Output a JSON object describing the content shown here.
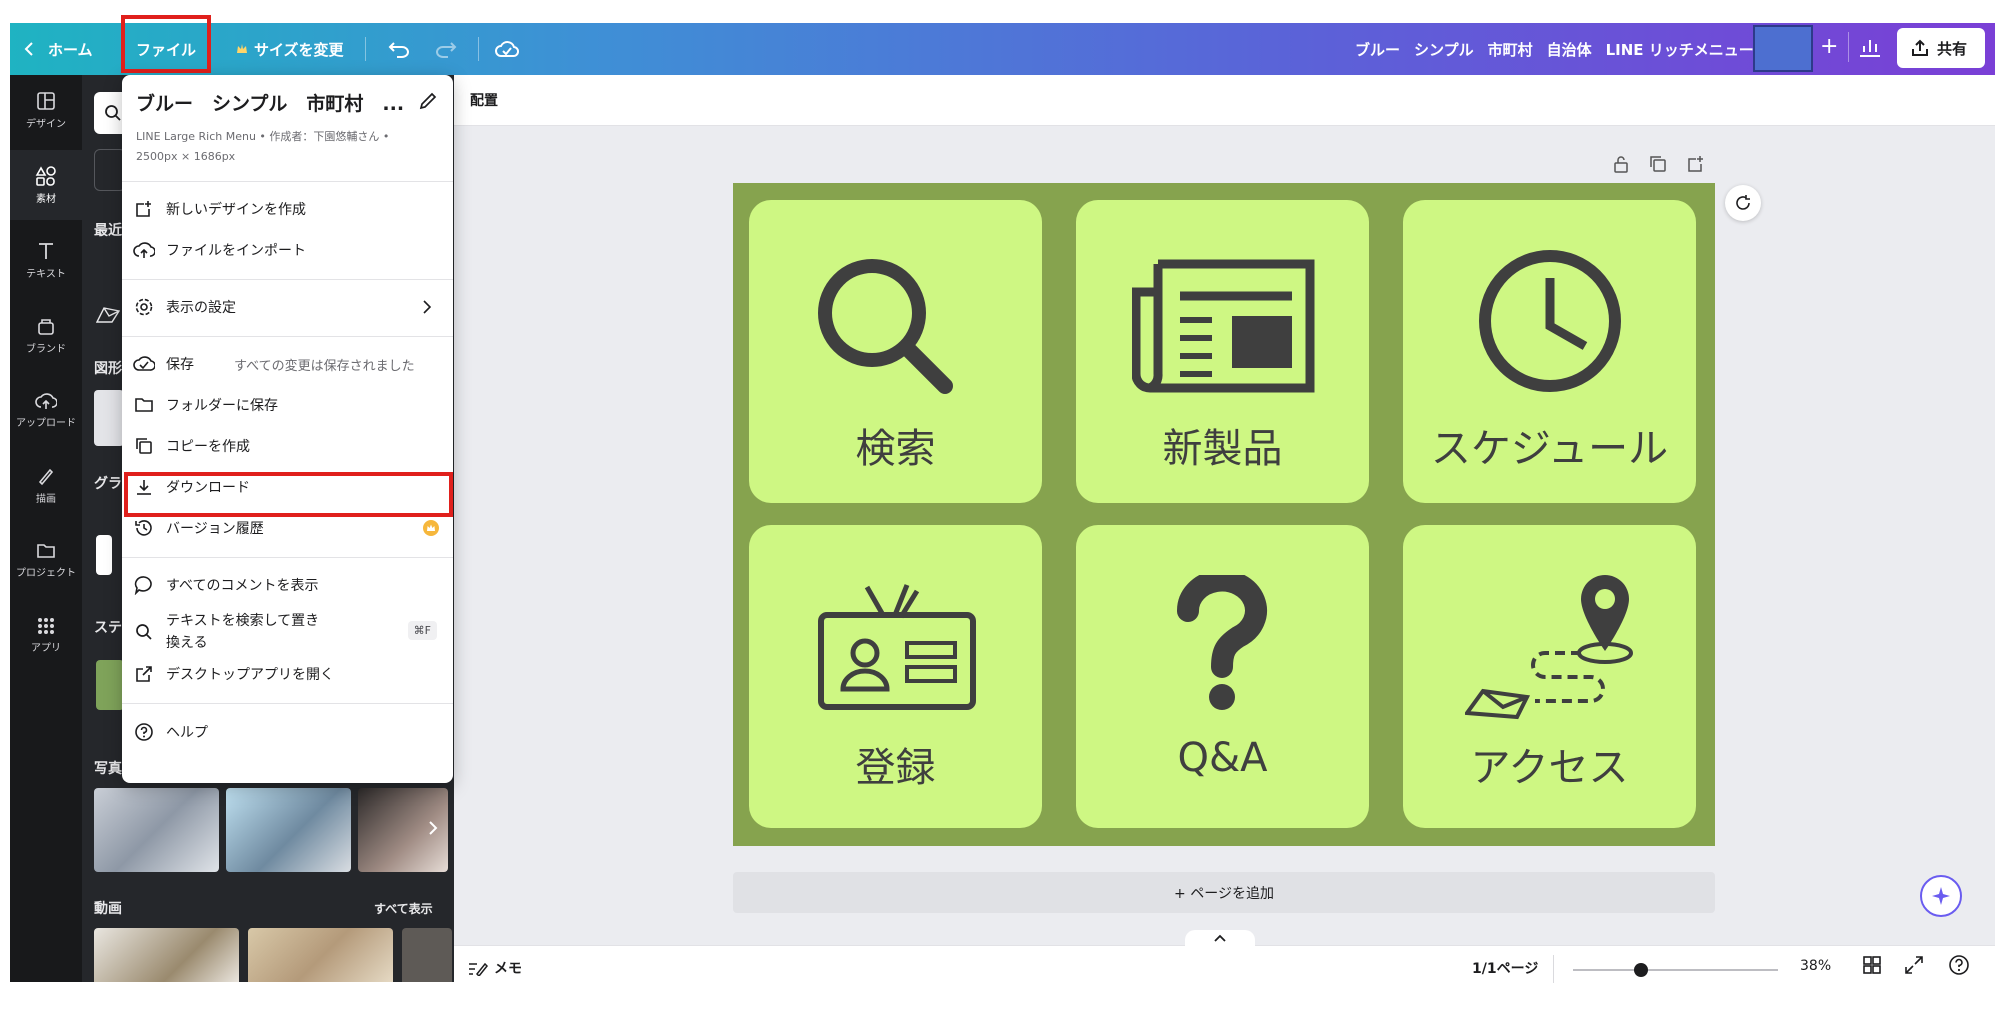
{
  "topbar": {
    "home_label": "ホーム",
    "file_label": "ファイル",
    "resize_label": "サイズを変更",
    "title_tags": [
      "ブルー",
      "シンプル",
      "市町村",
      "自治体",
      "LINE リッチメニュー"
    ],
    "share_label": "共有",
    "swatch_color": "#4d6fd0"
  },
  "rail": [
    {
      "label": "デザイン",
      "icon": "layout-icon"
    },
    {
      "label": "素材",
      "icon": "elements-icon"
    },
    {
      "label": "テキスト",
      "icon": "text-icon"
    },
    {
      "label": "ブランド",
      "icon": "brand-icon"
    },
    {
      "label": "アップロード",
      "icon": "upload-icon"
    },
    {
      "label": "描画",
      "icon": "draw-icon"
    },
    {
      "label": "プロジェクト",
      "icon": "folder-icon"
    },
    {
      "label": "アプリ",
      "icon": "apps-icon"
    }
  ],
  "panel": {
    "recent_label": "最近",
    "shapes_label": "図形",
    "graphics_label": "グラ",
    "stickers_label": "ステ",
    "photos_label": "写真",
    "videos_label": "動画",
    "see_all": "すべて表示"
  },
  "context_bar": {
    "arrange_label": "配置"
  },
  "file_menu": {
    "title": "ブルー　シンプル　市町村　...",
    "meta_line1": "LINE Large Rich Menu • 作成者：下園悠輔さん •",
    "meta_line2": "2500px × 1686px",
    "items": {
      "new_design": "新しいデザインを作成",
      "import": "ファイルをインポート",
      "view_settings": "表示の設定",
      "save": "保存",
      "save_status": "すべての変更は保存されました",
      "save_to_folder": "フォルダーに保存",
      "make_copy": "コピーを作成",
      "download": "ダウンロード",
      "version_history": "バージョン履歴",
      "show_comments": "すべてのコメントを表示",
      "find_replace_1": "テキストを検索して置き",
      "find_replace_2": "換える",
      "find_shortcut": "⌘F",
      "open_desktop": "デスクトップアプリを開く",
      "help": "ヘルプ"
    }
  },
  "design_tiles": [
    {
      "label": "検索",
      "icon": "magnifier-icon"
    },
    {
      "label": "新製品",
      "icon": "newspaper-icon"
    },
    {
      "label": "スケジュール",
      "icon": "clock-icon"
    },
    {
      "label": "登録",
      "icon": "id-card-icon"
    },
    {
      "label": "Q&A",
      "icon": "question-mark-icon"
    },
    {
      "label": "アクセス",
      "icon": "map-pin-route-icon"
    }
  ],
  "canvas": {
    "add_page": "+ ページを追加"
  },
  "bottombar": {
    "notes_label": "メモ",
    "page_indicator": "1/1ページ",
    "zoom": "38%",
    "zoom_level": 0.33
  },
  "colors": {
    "design_bg": "#86a34e",
    "tile_bg": "#cef783",
    "icon_color": "#3f3f3f",
    "highlight": "#e0201c"
  }
}
